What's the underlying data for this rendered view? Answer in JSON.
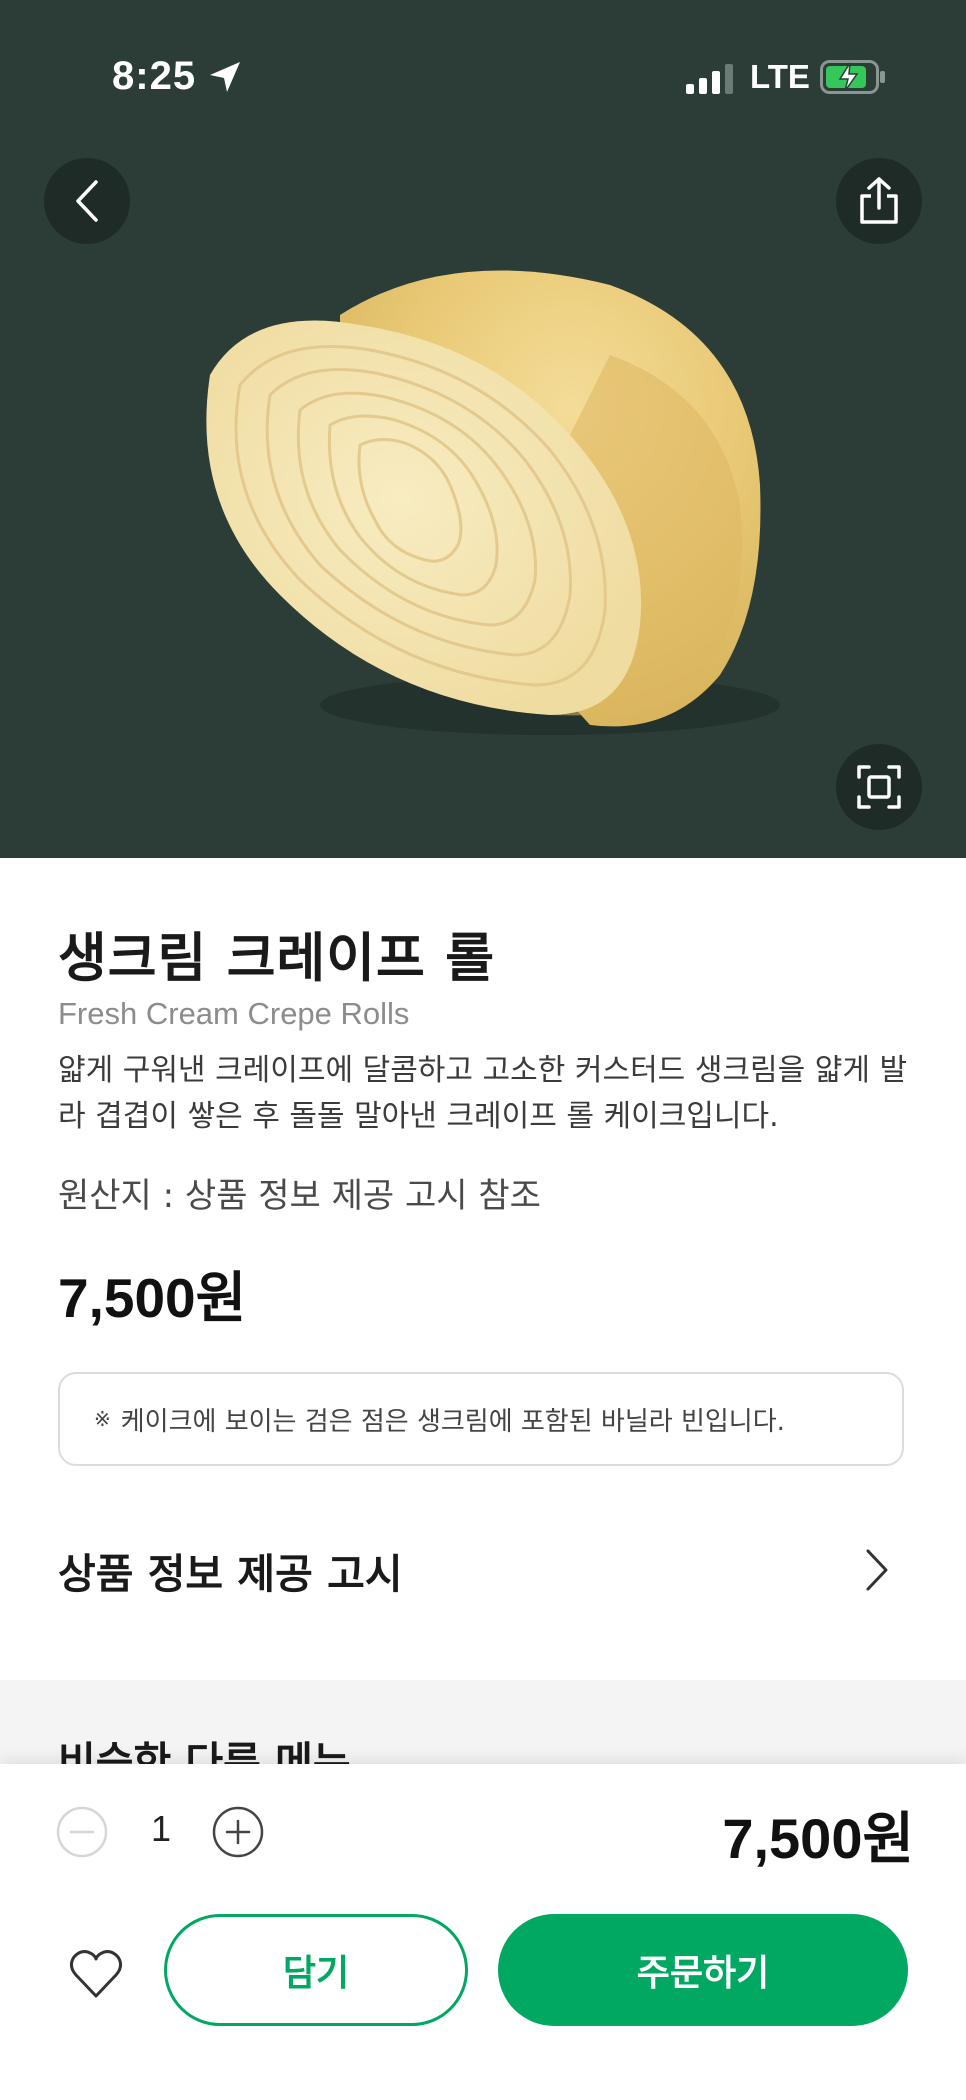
{
  "status_bar": {
    "time": "8:25",
    "network": "LTE"
  },
  "icons": {
    "back": "chevron-left-icon",
    "share": "share-icon",
    "zoom": "fullscreen-icon",
    "more": "chevron-right-icon",
    "favorite": "heart-icon",
    "minus": "minus-circle-icon",
    "plus": "plus-circle-icon"
  },
  "colors": {
    "hero_bg": "#2c3c37",
    "accent": "#00a862"
  },
  "product": {
    "name_ko": "생크림 크레이프 롤",
    "name_en": "Fresh Cream Crepe Rolls",
    "description": "얇게 구워낸 크레이프에 달콤하고 고소한 커스터드 생크림을 얇게 발라 겹겹이 쌓은 후 돌돌 말아낸 크레이프 롤 케이크입니다.",
    "origin": "원산지 : 상품 정보 제공 고시 참조",
    "price": "7,500원",
    "notice_mark": "※",
    "notice": "케이크에 보이는 검은 점은 생크림에 포함된 바닐라 빈입니다."
  },
  "sections": {
    "product_info": "상품 정보 제공 고시",
    "similar_menu": "비슷한 다른 메뉴"
  },
  "order": {
    "quantity": "1",
    "total": "7,500원",
    "cart_label": "담기",
    "order_label": "주문하기"
  }
}
